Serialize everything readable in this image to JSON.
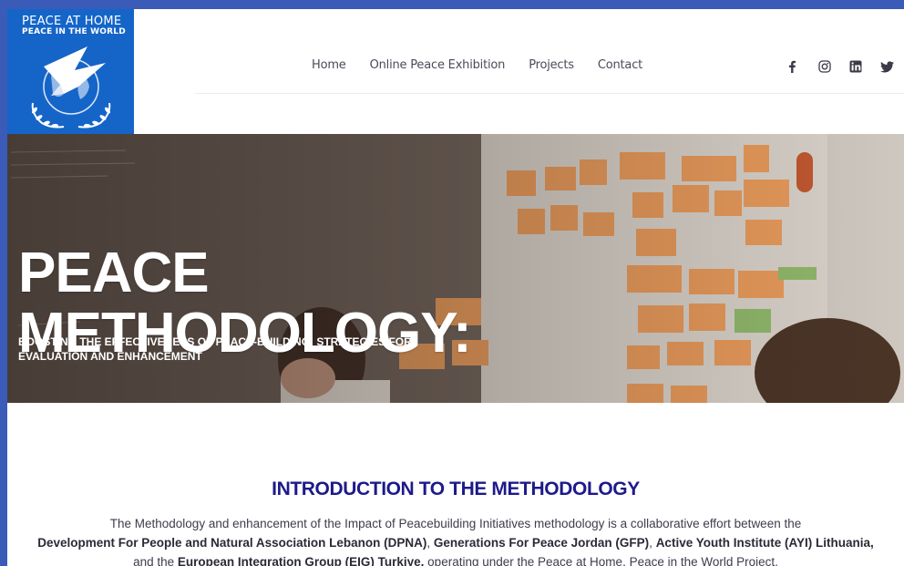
{
  "logo": {
    "line1": "PEACE AT HOME",
    "line2": "PEACE IN THE WORLD",
    "bg_color": "#1565c8"
  },
  "nav": {
    "items": [
      "Home",
      "Online Peace Exhibition",
      "Projects",
      "Contact"
    ]
  },
  "social": {
    "icons": [
      "facebook-icon",
      "instagram-icon",
      "linkedin-icon",
      "twitter-icon"
    ],
    "glyphs": [
      "f",
      "◎",
      "in",
      "🐦"
    ]
  },
  "hero": {
    "title_line1": "PEACE",
    "title_line2": "METHODOLOGY:",
    "subtitle": "BOOSTING THE EFFECTIVENESS OF PEACE-BUILDING: STRATEGIES FOR EVALUATION AND ENHANCEMENT"
  },
  "intro": {
    "heading": "INTRODUCTION TO THE METHODOLOGY",
    "text_1": "The Methodology and enhancement of the Impact of Peacebuilding Initiatives methodology is a collaborative effort between the",
    "org_1": "Development For People and Natural Association Lebanon (DPNA)",
    "sep_1": ", ",
    "org_2": "Generations For Peace Jordan (GFP)",
    "sep_2": ", ",
    "org_3": "Active Youth Institute (AYI) Lithuania,",
    "sep_3": " and the ",
    "org_4": "European Integration Group (EIG) Turkiye,",
    "text_2": " operating under the Peace at Home, Peace in the World Project.",
    "heading_color": "#1d1a8a"
  },
  "colors": {
    "frame": "#3a5bb8",
    "accent": "#1565c8"
  }
}
